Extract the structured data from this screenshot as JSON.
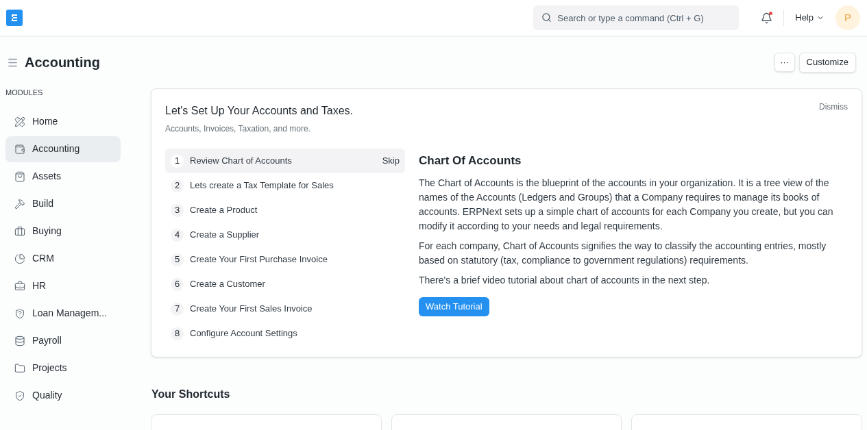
{
  "navbar": {
    "search": {
      "placeholder": "Search or type a command (Ctrl + G)"
    },
    "notification_unread": true,
    "help": "Help",
    "avatar": "P"
  },
  "page": {
    "title": "Accounting",
    "more": "···",
    "customize": "Customize"
  },
  "sidebar": {
    "heading": "MODULES",
    "items": [
      {
        "label": "Home",
        "selected": false
      },
      {
        "label": "Accounting",
        "selected": true
      },
      {
        "label": "Assets",
        "selected": false
      },
      {
        "label": "Build",
        "selected": false
      },
      {
        "label": "Buying",
        "selected": false
      },
      {
        "label": "CRM",
        "selected": false
      },
      {
        "label": "HR",
        "selected": false
      },
      {
        "label": "Loan Managem...",
        "selected": false
      },
      {
        "label": "Payroll",
        "selected": false
      },
      {
        "label": "Projects",
        "selected": false
      },
      {
        "label": "Quality",
        "selected": false
      }
    ]
  },
  "onboarding": {
    "title": "Let's Set Up Your Accounts and Taxes.",
    "subtitle": "Accounts, Invoices, Taxation, and more.",
    "dismiss": "Dismiss",
    "steps": [
      {
        "number": "1",
        "label": "Review Chart of Accounts",
        "selected": true,
        "action": "Skip"
      },
      {
        "number": "2",
        "label": "Lets create a Tax Template for Sales",
        "selected": false
      },
      {
        "number": "3",
        "label": "Create a Product",
        "selected": false
      },
      {
        "number": "4",
        "label": "Create a Supplier",
        "selected": false
      },
      {
        "number": "5",
        "label": "Create Your First Purchase Invoice",
        "selected": false
      },
      {
        "number": "6",
        "label": "Create a Customer",
        "selected": false
      },
      {
        "number": "7",
        "label": "Create Your First Sales Invoice",
        "selected": false
      },
      {
        "number": "8",
        "label": "Configure Account Settings",
        "selected": false
      }
    ],
    "detail": {
      "title": "Chart Of Accounts",
      "paragraphs": [
        "The Chart of Accounts is the blueprint of the accounts in your organization. It is a tree view of the names of the Accounts (Ledgers and Groups) that a Company requires to manage its books of accounts. ERPNext sets up a simple chart of accounts for each Company you create, but you can modify it according to your needs and legal requirements.",
        "For each company, Chart of Accounts signifies the way to classify the accounting entries, mostly based on statutory (tax, compliance to government regulations) requirements.",
        "There's a brief video tutorial about chart of accounts in the next step."
      ],
      "button": "Watch Tutorial"
    }
  },
  "shortcuts": {
    "title": "Your Shortcuts"
  }
}
